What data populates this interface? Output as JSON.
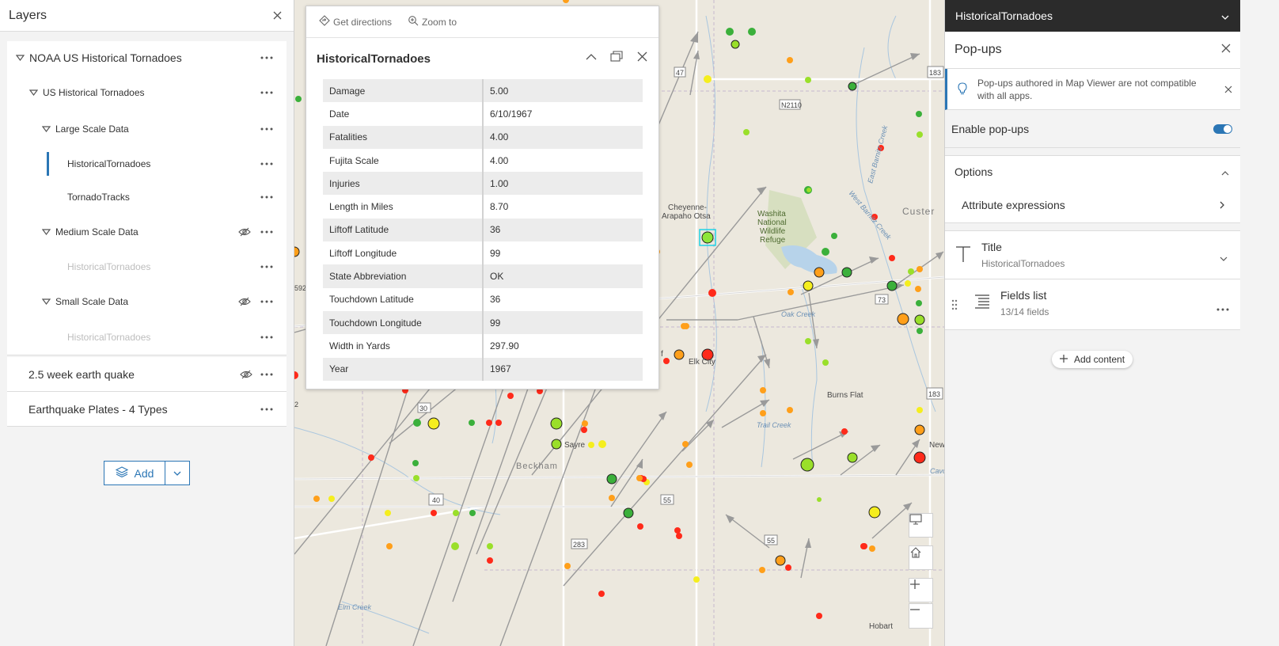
{
  "layers_panel": {
    "title": "Layers",
    "groups": [
      {
        "label": "NOAA US Historical Tornadoes",
        "child": {
          "label": "US Historical Tornadoes",
          "large": {
            "label": "Large Scale Data",
            "items": [
              "HistoricalTornadoes",
              "TornadoTracks"
            ]
          },
          "medium": {
            "label": "Medium Scale Data",
            "items": [
              "HistoricalTornadoes"
            ]
          },
          "small": {
            "label": "Small Scale Data",
            "items": [
              "HistoricalTornadoes"
            ]
          }
        }
      }
    ],
    "other_layers": [
      "2.5 week earth quake",
      "Earthquake Plates - 4 Types"
    ],
    "add_label": "Add"
  },
  "popup": {
    "get_directions": "Get directions",
    "zoom_to": "Zoom to",
    "title": "HistoricalTornadoes",
    "fields": [
      {
        "k": "Damage",
        "v": "5.00"
      },
      {
        "k": "Date",
        "v": "6/10/1967"
      },
      {
        "k": "Fatalities",
        "v": "4.00"
      },
      {
        "k": "Fujita Scale",
        "v": "4.00"
      },
      {
        "k": "Injuries",
        "v": "1.00"
      },
      {
        "k": "Length in Miles",
        "v": "8.70"
      },
      {
        "k": "Liftoff Latitude",
        "v": "36"
      },
      {
        "k": "Liftoff Longitude",
        "v": "99"
      },
      {
        "k": "State Abbreviation",
        "v": "OK"
      },
      {
        "k": "Touchdown Latitude",
        "v": "36"
      },
      {
        "k": "Touchdown Longitude",
        "v": "99"
      },
      {
        "k": "Width in Yards",
        "v": "297.90"
      },
      {
        "k": "Year",
        "v": "1967"
      }
    ]
  },
  "map": {
    "labels": {
      "cheyenne": "Cheyenne-",
      "arapaho": "Arapaho Otsa",
      "washita1": "Washita",
      "washita2": "National",
      "washita3": "Wildlife",
      "washita4": "Refuge",
      "custer": "Custer",
      "elk_city": "Elk City",
      "burns_flat": "Burns Flat",
      "sayre": "Sayre",
      "beckham": "Beckham",
      "hobart": "Hobart",
      "new": "New",
      "oak_creek": "Oak Creek",
      "elm_creek": "Elm Creek",
      "trail_creek": "Trail Creek",
      "west_barnitz": "West Barnitz Creek",
      "east_barnitz": "East Barnitz Creek",
      "cavo": "Cavo",
      "n2110": "N2110",
      "r47": "47",
      "r183a": "183",
      "r183b": "183",
      "r73": "73",
      "r30": "30",
      "r40": "40",
      "r55a": "55",
      "r55b": "55",
      "r283": "283",
      "r592": "592",
      "r2": "2",
      "f": "f"
    }
  },
  "right_panel": {
    "layer_name": "HistoricalTornadoes",
    "section_title": "Pop-ups",
    "notice": "Pop-ups authored in Map Viewer are not compatible with all apps.",
    "enable_label": "Enable pop-ups",
    "options_label": "Options",
    "attribute_expressions": "Attribute expressions",
    "title_label": "Title",
    "title_value": "HistoricalTornadoes",
    "fields_label": "Fields list",
    "fields_count": "13/14 fields",
    "add_content": "Add content"
  },
  "colors": {
    "accent": "#2b76b5",
    "dark_header": "#2b2b2b",
    "selected_point": "#8ee63a"
  },
  "icons": [
    "close-icon",
    "caret-down-icon",
    "more-icon",
    "eye-icon",
    "layers-icon",
    "chevron-down-icon",
    "directions-icon",
    "zoom-icon",
    "chevron-up-icon",
    "dock-icon",
    "lightbulb-icon",
    "chevron-right-icon",
    "text-icon",
    "list-icon",
    "grip-icon",
    "plus-icon",
    "home-icon",
    "screen-icon",
    "minus-icon"
  ]
}
